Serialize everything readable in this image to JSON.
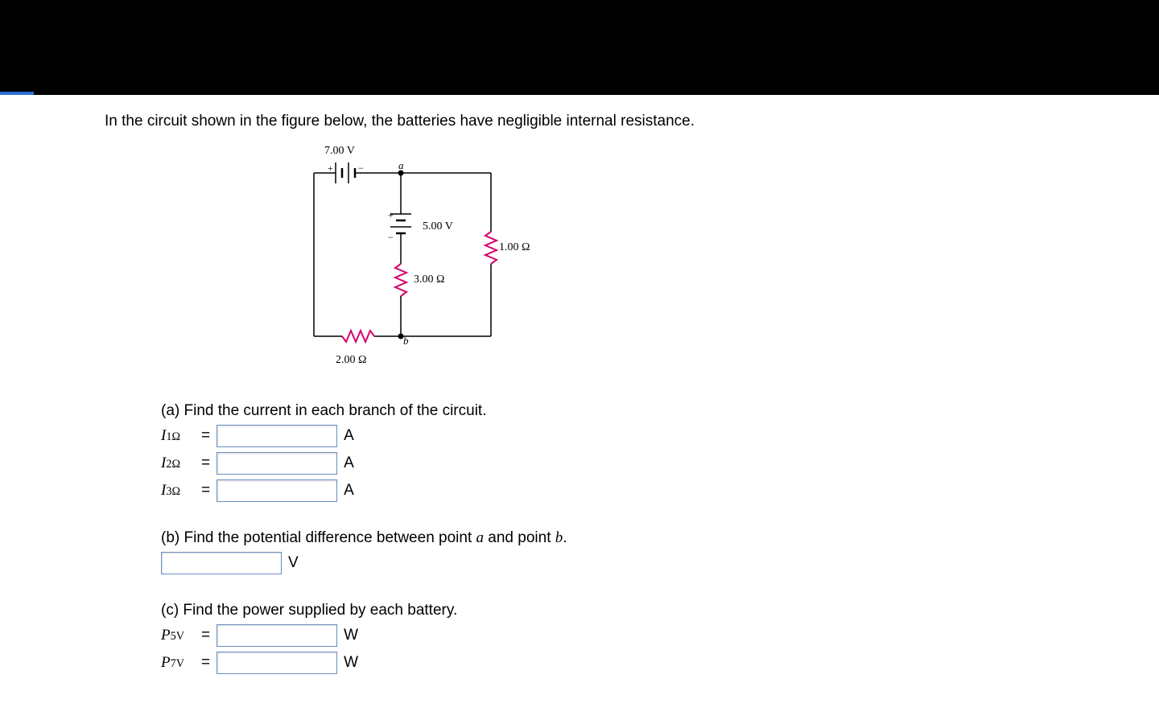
{
  "prompt": "In the circuit shown in the figure below, the batteries have negligible internal resistance.",
  "diagram": {
    "v_top": "7.00 V",
    "v_mid": "5.00 V",
    "r_right": "1.00 Ω",
    "r_mid": "3.00 Ω",
    "r_bottom": "2.00 Ω",
    "node_a": "a",
    "node_b": "b",
    "plus": "+",
    "minus": "−"
  },
  "parts": {
    "a": {
      "prompt": "(a) Find the current in each branch of the circuit.",
      "rows": [
        {
          "sym_base": "I",
          "sym_sub": "1Ω",
          "unit": "A"
        },
        {
          "sym_base": "I",
          "sym_sub": "2Ω",
          "unit": "A"
        },
        {
          "sym_base": "I",
          "sym_sub": "3Ω",
          "unit": "A"
        }
      ]
    },
    "b": {
      "prompt_html": "(b) Find the potential difference between point ",
      "a": "a",
      "mid": " and point ",
      "bpt": "b",
      "end": ".",
      "unit": "V"
    },
    "c": {
      "prompt": "(c) Find the power supplied by each battery.",
      "rows": [
        {
          "sym_base": "P",
          "sym_sub": "5V",
          "unit": "W"
        },
        {
          "sym_base": "P",
          "sym_sub": "7V",
          "unit": "W"
        }
      ]
    }
  },
  "eq_sign": " = "
}
